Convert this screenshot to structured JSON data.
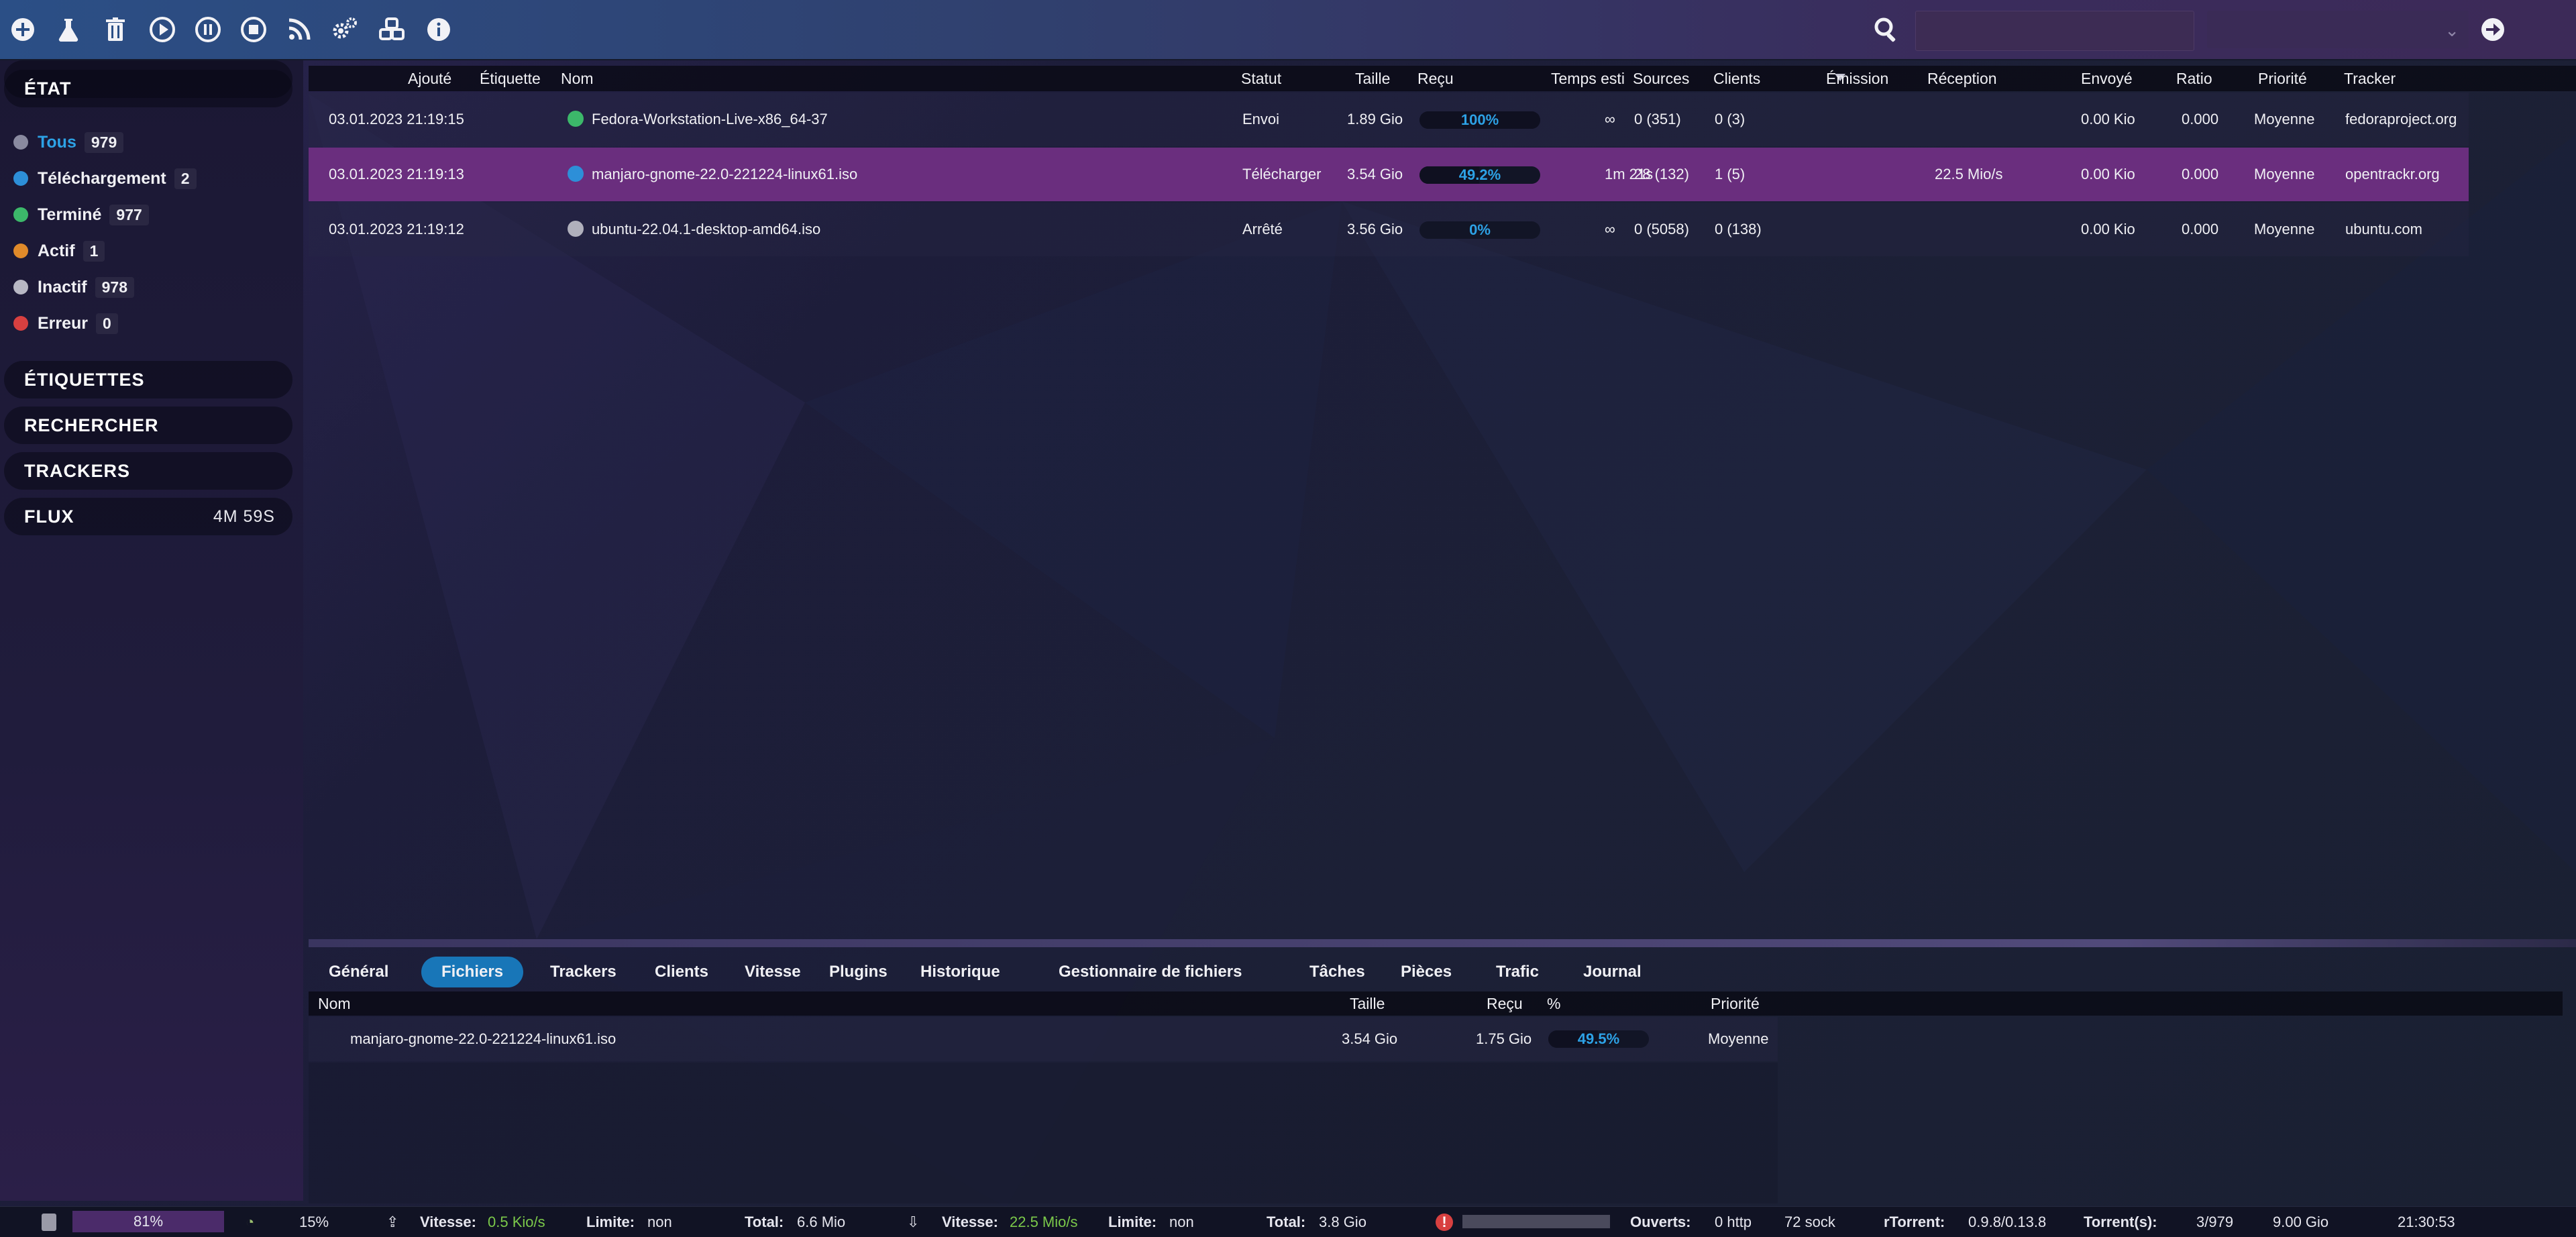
{
  "toolbar": {
    "icons": [
      "add-icon",
      "create-torrent-icon",
      "delete-icon",
      "start-icon",
      "pause-icon",
      "stop-icon",
      "rss-icon",
      "settings-icon",
      "plugins-icon",
      "about-icon"
    ],
    "search_value": "",
    "filter_value": ""
  },
  "sidebar": {
    "state_header": "ÉTAT",
    "states": [
      {
        "label": "Tous",
        "count": "979",
        "color": "#8a8aa0",
        "active": true
      },
      {
        "label": "Téléchargement",
        "count": "2",
        "color": "#2d8fd8"
      },
      {
        "label": "Terminé",
        "count": "977",
        "color": "#3cb86a"
      },
      {
        "label": "Actif",
        "count": "1",
        "color": "#e08a2a"
      },
      {
        "label": "Inactif",
        "count": "978",
        "color": "#b8b8c4"
      },
      {
        "label": "Erreur",
        "count": "0",
        "color": "#d84040"
      }
    ],
    "labels_header": "ÉTIQUETTES",
    "search_header": "RECHERCHER",
    "trackers_header": "TRACKERS",
    "feeds_header": "FLUX",
    "feeds_timer": "4M 59S"
  },
  "list": {
    "columns": {
      "added": "Ajouté",
      "label": "Étiquette",
      "name": "Nom",
      "status": "Statut",
      "size": "Taille",
      "received": "Reçu",
      "eta": "Temps esti",
      "seeds": "Sources",
      "peers": "Clients",
      "up": "Émission",
      "down": "Réception",
      "sent": "Envoyé",
      "ratio": "Ratio",
      "priority": "Priorité",
      "tracker": "Tracker"
    },
    "rows": [
      {
        "added": "03.01.2023 21:19:15",
        "name": "Fedora-Workstation-Live-x86_64-37",
        "status": "Envoi",
        "size": "1.89 Gio",
        "progress_text": "100%",
        "progress": 1.0,
        "eta": "∞",
        "seeds": "0 (351)",
        "peers": "0 (3)",
        "up": "",
        "down": "",
        "sent": "0.00 Kio",
        "ratio": "0.000",
        "priority": "Moyenne",
        "tracker": "fedoraproject.org",
        "dot": "#3cb86a"
      },
      {
        "added": "03.01.2023 21:19:13",
        "name": "manjaro-gnome-22.0-221224-linux61.iso",
        "status": "Télécharger",
        "size": "3.54 Gio",
        "progress_text": "49.2%",
        "progress": 0.492,
        "eta": "1m 21s",
        "seeds": "28 (132)",
        "peers": "1 (5)",
        "up": "",
        "down": "22.5 Mio/s",
        "sent": "0.00 Kio",
        "ratio": "0.000",
        "priority": "Moyenne",
        "tracker": "opentrackr.org",
        "dot": "#2d8fd8"
      },
      {
        "added": "03.01.2023 21:19:12",
        "name": "ubuntu-22.04.1-desktop-amd64.iso",
        "status": "Arrêté",
        "size": "3.56 Gio",
        "progress_text": "0%",
        "progress": 0.0,
        "eta": "∞",
        "seeds": "0 (5058)",
        "peers": "0 (138)",
        "up": "",
        "down": "",
        "sent": "0.00 Kio",
        "ratio": "0.000",
        "priority": "Moyenne",
        "tracker": "ubuntu.com",
        "dot": "#b0b0bc"
      }
    ]
  },
  "tabs": [
    "Général",
    "Fichiers",
    "Trackers",
    "Clients",
    "Vitesse",
    "Plugins",
    "Historique",
    "Gestionnaire de fichiers",
    "Tâches",
    "Pièces",
    "Trafic",
    "Journal"
  ],
  "active_tab": "Fichiers",
  "files": {
    "columns": {
      "name": "Nom",
      "size": "Taille",
      "received": "Reçu",
      "percent": "%",
      "priority": "Priorité"
    },
    "row": {
      "name": "manjaro-gnome-22.0-221224-linux61.iso",
      "size": "3.54 Gio",
      "received": "1.75 Gio",
      "percent_text": "49.5%",
      "progress": 0.495,
      "priority": "Moyenne"
    }
  },
  "statusbar": {
    "disk_percent": "81%",
    "cpu_percent": "15%",
    "up_speed_label": "Vitesse:",
    "up_speed": "0.5 Kio/s",
    "up_limit_label": "Limite:",
    "up_limit": "non",
    "up_total_label": "Total:",
    "up_total": "6.6 Mio",
    "down_speed_label": "Vitesse:",
    "down_speed": "22.5 Mio/s",
    "down_limit_label": "Limite:",
    "down_limit": "non",
    "down_total_label": "Total:",
    "down_total": "3.8 Gio",
    "open_label": "Ouverts:",
    "open_http": "0 http",
    "open_sock": "72 sock",
    "client_label": "rTorrent:",
    "client_version": "0.9.8/0.13.8",
    "torrents_label": "Torrent(s):",
    "torrents_count": "3/979",
    "free_space": "9.00 Gio",
    "time": "21:30:53"
  }
}
